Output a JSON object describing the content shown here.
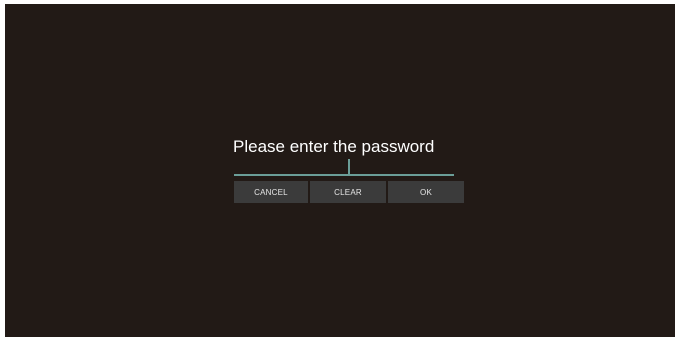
{
  "dialog": {
    "prompt": "Please enter the password",
    "password_value": ""
  },
  "buttons": {
    "cancel_label": "CANCEL",
    "clear_label": "CLEAR",
    "ok_label": "OK"
  },
  "colors": {
    "background": "#221a16",
    "accent": "#6b9e98",
    "button_bg": "#3b3b3b",
    "text": "#ffffff"
  }
}
